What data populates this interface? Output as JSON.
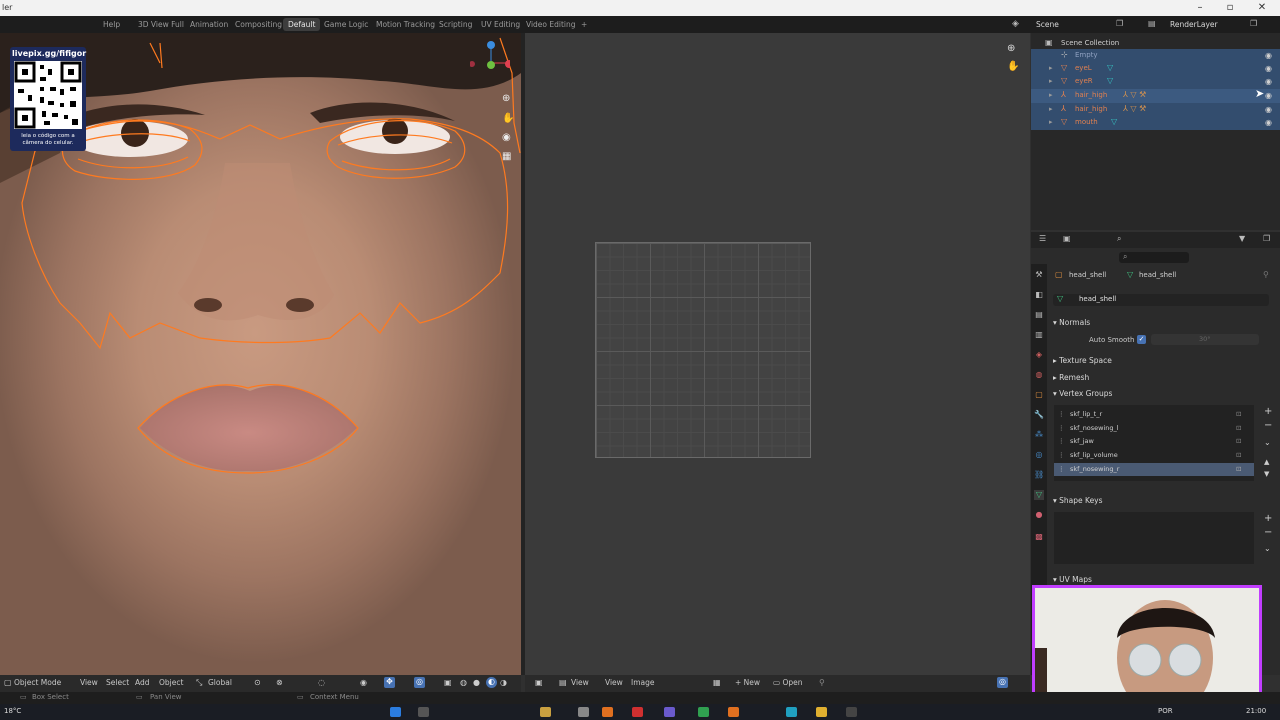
{
  "window": {
    "title": "ler"
  },
  "menubar": {
    "help": "Help",
    "workspaces": [
      "3D View Full",
      "Animation",
      "Compositing",
      "Default",
      "Game Logic",
      "Motion Tracking",
      "Scripting",
      "UV Editing",
      "Video Editing"
    ],
    "active_workspace": "Default",
    "add_tab": "+",
    "scene": "Scene",
    "view_layer": "RenderLayer"
  },
  "overlay": {
    "handle": "livepix.gg/fifigor",
    "caption": "leia o código com a câmera do celular."
  },
  "outliner": {
    "root": "Scene Collection",
    "items": [
      {
        "name": "Empty",
        "selected": true
      },
      {
        "name": "eyeL",
        "selected": true
      },
      {
        "name": "eyeR",
        "selected": true
      },
      {
        "name": "hair_high",
        "selected": true
      },
      {
        "name": "hair_high",
        "selected": true
      },
      {
        "name": "mouth",
        "selected": true
      }
    ]
  },
  "properties": {
    "breadcrumb_object": "head_shell",
    "breadcrumb_mesh": "head_shell",
    "mesh_name": "head_shell",
    "panels": {
      "normals": "Normals",
      "auto_smooth": "Auto Smooth",
      "auto_smooth_angle": "30°",
      "texture_space": "Texture Space",
      "remesh": "Remesh",
      "vertex_groups": "Vertex Groups",
      "shape_keys": "Shape Keys",
      "uv_maps": "UV Maps"
    },
    "vertex_groups": [
      "skf_lip_t_r",
      "skf_nosewing_l",
      "skf_jaw",
      "skf_lip_volume",
      "skf_nosewing_r"
    ],
    "active_vertex_group": "skf_nosewing_r"
  },
  "viewport_header": {
    "mode": "Object Mode",
    "menus": [
      "View",
      "Select",
      "Add",
      "Object"
    ],
    "transform": "Global"
  },
  "image_header": {
    "menus": [
      "View",
      "View",
      "Image"
    ],
    "new": "New",
    "open": "Open"
  },
  "statusbar": {
    "box_select": "Box Select",
    "pan_view": "Pan View",
    "context_menu": "Context Menu"
  },
  "taskbar": {
    "temp": "18°C",
    "lang": "POR",
    "time": "21:00"
  },
  "colors": {
    "selection_outline": "#ff7a1f",
    "outliner_selected": "#334d6e",
    "accent_blue": "#4772b3",
    "webcam_border": "#c13dff"
  }
}
